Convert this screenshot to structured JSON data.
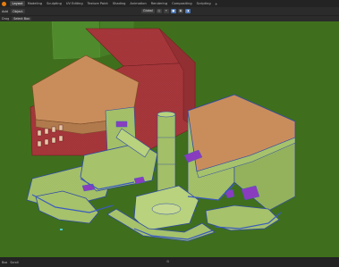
{
  "workspaces": [
    "Layout",
    "Modeling",
    "Sculpting",
    "UV Editing",
    "Texture Paint",
    "Shading",
    "Animation",
    "Rendering",
    "Compositing",
    "Scripting"
  ],
  "active_workspace": "Layout",
  "add_workspace": "+",
  "header": {
    "mode_icon": "edit-mode-icon",
    "menus": [
      "Add",
      "Object"
    ],
    "orientation": "Global",
    "snap_icons": [
      "transform-pivot-icon",
      "snap-icon",
      "proportional-icon",
      "overlay-icon",
      "shading-icon"
    ]
  },
  "toolrow": {
    "drag_label": "Drag",
    "select_mode": "Select Box"
  },
  "status": {
    "left_text": "Box",
    "scroll_text": "Scroll",
    "icon": "mouse-icon"
  },
  "colors": {
    "viewport_bg": "#3f6f1c",
    "wall_green": "#a6c26b",
    "roof_tan": "#c98d5c",
    "red_wall": "#a8383c",
    "edge_blue": "#3a5bbf",
    "accent_purple": "#8a3cbf"
  }
}
